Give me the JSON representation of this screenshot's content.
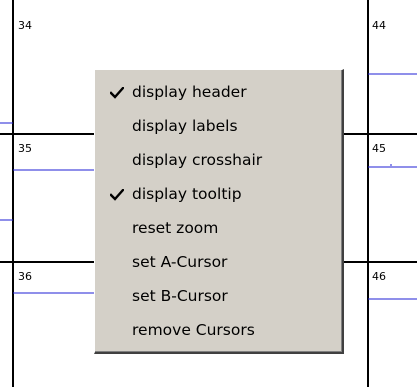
{
  "cells": [
    {
      "number": "34"
    },
    {
      "number": "44"
    },
    {
      "number": "35"
    },
    {
      "number": "45"
    },
    {
      "number": "36"
    },
    {
      "number": "46"
    }
  ],
  "context_menu": {
    "items": [
      {
        "label": "display header",
        "checked": true
      },
      {
        "label": "display labels",
        "checked": false
      },
      {
        "label": "display crosshair",
        "checked": false
      },
      {
        "label": "display tooltip",
        "checked": true
      },
      {
        "label": "reset zoom",
        "checked": false
      },
      {
        "label": "set A-Cursor",
        "checked": false
      },
      {
        "label": "set B-Cursor",
        "checked": false
      },
      {
        "label": "remove Cursors",
        "checked": false
      }
    ]
  },
  "colors": {
    "menu_background": "#d4d0c8",
    "grid_line": "#000000",
    "trace_line": "#0000cc"
  }
}
